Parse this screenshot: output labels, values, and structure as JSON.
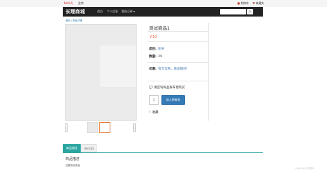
{
  "topbar": {
    "left_link": "Hell 凡",
    "left_link2": "注销",
    "right_cart": "购物车",
    "right_fav": "收藏夹"
  },
  "navbar": {
    "brand": "长理商城",
    "links": [
      "首页",
      "个人信息",
      "我的订单 ▾"
    ],
    "search_placeholder": "搜索"
  },
  "breadcrumb": {
    "home": "首页",
    "sep": " / ",
    "current": "商品详情"
  },
  "product": {
    "title": "测试商品1",
    "price": "￥10",
    "category_label": "类别:",
    "category_value": "图书",
    "stock_label": "数量:",
    "stock_value": "29",
    "promo_label": "优惠:",
    "promo_value": "暂无优惠，敬请期待!",
    "contact": "请咨询商品发布者购买",
    "quantity": "1",
    "add_to_cart": "加入购物车",
    "favorite": "收藏"
  },
  "tabs": {
    "description": "商品描述",
    "reviews": "评价(0)"
  },
  "description": {
    "title": "商品描述",
    "text": "这是测试商品"
  },
  "watermark": "CSDN @小凡不酷吖",
  "colors": {
    "navbar_bg": "#222222",
    "price": "#e35b3a",
    "primary_button": "#337ab7",
    "tab_active": "#2aa6a2",
    "thumb_active_border": "#e2752f"
  }
}
